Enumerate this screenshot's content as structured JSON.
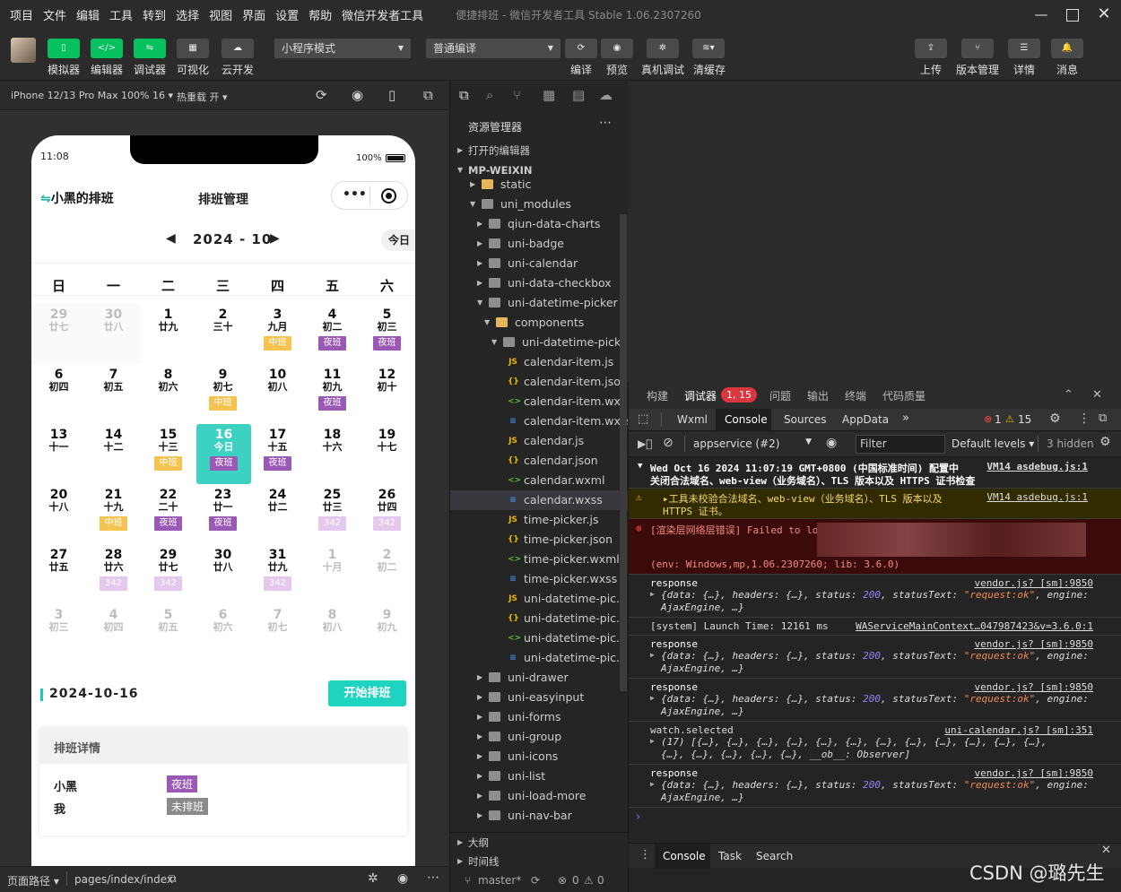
{
  "menubar": {
    "items": [
      "项目",
      "文件",
      "编辑",
      "工具",
      "转到",
      "选择",
      "视图",
      "界面",
      "设置",
      "帮助",
      "微信开发者工具"
    ],
    "title": "便捷排班 - 微信开发者工具 Stable 1.06.2307260"
  },
  "toolbar": {
    "left": [
      "模拟器",
      "编辑器",
      "调试器",
      "可视化",
      "云开发"
    ],
    "mode": "小程序模式",
    "compile": "普通编译",
    "actions": [
      "编译",
      "预览",
      "真机调试",
      "清缓存"
    ],
    "right": [
      "上传",
      "版本管理",
      "详情",
      "消息"
    ]
  },
  "simbar": {
    "device": "iPhone 12/13 Pro Max 100% 16",
    "hotreload": "热重载 开"
  },
  "phone": {
    "time": "11:08",
    "battery": "100%",
    "app_title": "小黑的排班",
    "page_title": "排班管理",
    "month": "2024 - 10",
    "today": "今日",
    "weekdays": [
      "日",
      "一",
      "二",
      "三",
      "四",
      "五",
      "六"
    ],
    "cells": [
      [
        "29",
        "廿七",
        "",
        1
      ],
      [
        "30",
        "廿八",
        "",
        1
      ],
      [
        "1",
        "廿九",
        "",
        0
      ],
      [
        "2",
        "三十",
        "",
        0
      ],
      [
        "3",
        "九月",
        "中班",
        0
      ],
      [
        "4",
        "初二",
        "夜班",
        0
      ],
      [
        "5",
        "初三",
        "夜班",
        0
      ],
      [
        "6",
        "初四",
        "",
        0
      ],
      [
        "7",
        "初五",
        "",
        0
      ],
      [
        "8",
        "初六",
        "",
        0
      ],
      [
        "9",
        "初七",
        "中班",
        0
      ],
      [
        "10",
        "初八",
        "",
        0
      ],
      [
        "11",
        "初九",
        "夜班",
        0
      ],
      [
        "12",
        "初十",
        "",
        0
      ],
      [
        "13",
        "十一",
        "",
        0
      ],
      [
        "14",
        "十二",
        "",
        0
      ],
      [
        "15",
        "十三",
        "中班",
        0
      ],
      [
        "16",
        "今日",
        "夜班",
        2
      ],
      [
        "17",
        "十五",
        "夜班",
        0
      ],
      [
        "18",
        "十六",
        "",
        0
      ],
      [
        "19",
        "十七",
        "",
        0
      ],
      [
        "20",
        "十八",
        "",
        0
      ],
      [
        "21",
        "十九",
        "中班",
        0
      ],
      [
        "22",
        "二十",
        "夜班",
        0
      ],
      [
        "23",
        "廿一",
        "夜班",
        0
      ],
      [
        "24",
        "廿二",
        "",
        0
      ],
      [
        "25",
        "廿三",
        "342",
        0
      ],
      [
        "26",
        "廿四",
        "342",
        0
      ],
      [
        "27",
        "廿五",
        "",
        0
      ],
      [
        "28",
        "廿六",
        "342",
        0
      ],
      [
        "29",
        "廿七",
        "342",
        0
      ],
      [
        "30",
        "廿八",
        "",
        0
      ],
      [
        "31",
        "廿九",
        "342",
        0
      ],
      [
        "1",
        "十月",
        "",
        1
      ],
      [
        "2",
        "初二",
        "",
        1
      ],
      [
        "3",
        "初三",
        "",
        1
      ],
      [
        "4",
        "初四",
        "",
        1
      ],
      [
        "5",
        "初五",
        "",
        1
      ],
      [
        "6",
        "初六",
        "",
        1
      ],
      [
        "7",
        "初七",
        "",
        1
      ],
      [
        "8",
        "初八",
        "",
        1
      ],
      [
        "9",
        "初九",
        "",
        1
      ]
    ],
    "tag_colors": {
      "中班": "#f5c350",
      "夜班": "#9b59b6",
      "342": "#e4c8ee",
      "未排班": "#8a8a8a"
    },
    "selected_date": "2024-10-16",
    "start_button": "开始排班",
    "detail_title": "排班详情",
    "detail_rows": [
      {
        "name": "小黑",
        "shift": "夜班"
      },
      {
        "name": "我",
        "shift": "未排班"
      }
    ]
  },
  "bottombar": {
    "path_label": "页面路径",
    "path": "pages/index/index"
  },
  "explorer": {
    "title": "资源管理器",
    "open_editors": "打开的编辑器",
    "root": "MP-WEIXIN",
    "outline": "大纲",
    "timeline": "时间线",
    "items": [
      {
        "label": "static",
        "depth": 1,
        "type": "folder-y",
        "open": false
      },
      {
        "label": "uni_modules",
        "depth": 1,
        "type": "folder",
        "open": true
      },
      {
        "label": "qiun-data-charts",
        "depth": 2,
        "type": "folder",
        "open": false
      },
      {
        "label": "uni-badge",
        "depth": 2,
        "type": "folder",
        "open": false
      },
      {
        "label": "uni-calendar",
        "depth": 2,
        "type": "folder",
        "open": false
      },
      {
        "label": "uni-data-checkbox",
        "depth": 2,
        "type": "folder",
        "open": false
      },
      {
        "label": "uni-datetime-picker",
        "depth": 2,
        "type": "folder",
        "open": true
      },
      {
        "label": "components",
        "depth": 3,
        "type": "folder-y",
        "open": true
      },
      {
        "label": "uni-datetime-picker",
        "depth": 4,
        "type": "folder",
        "open": true
      },
      {
        "label": "calendar-item.js",
        "depth": 5,
        "type": "js"
      },
      {
        "label": "calendar-item.json",
        "depth": 5,
        "type": "json"
      },
      {
        "label": "calendar-item.wx...",
        "depth": 5,
        "type": "wxml"
      },
      {
        "label": "calendar-item.wxss",
        "depth": 5,
        "type": "wxss"
      },
      {
        "label": "calendar.js",
        "depth": 5,
        "type": "js"
      },
      {
        "label": "calendar.json",
        "depth": 5,
        "type": "json"
      },
      {
        "label": "calendar.wxml",
        "depth": 5,
        "type": "wxml"
      },
      {
        "label": "calendar.wxss",
        "depth": 5,
        "type": "wxss",
        "selected": true
      },
      {
        "label": "time-picker.js",
        "depth": 5,
        "type": "js"
      },
      {
        "label": "time-picker.json",
        "depth": 5,
        "type": "json"
      },
      {
        "label": "time-picker.wxml",
        "depth": 5,
        "type": "wxml"
      },
      {
        "label": "time-picker.wxss",
        "depth": 5,
        "type": "wxss"
      },
      {
        "label": "uni-datetime-pic...",
        "depth": 5,
        "type": "js"
      },
      {
        "label": "uni-datetime-pic...",
        "depth": 5,
        "type": "json"
      },
      {
        "label": "uni-datetime-pic...",
        "depth": 5,
        "type": "wxml"
      },
      {
        "label": "uni-datetime-pic...",
        "depth": 5,
        "type": "wxss"
      },
      {
        "label": "uni-drawer",
        "depth": 2,
        "type": "folder",
        "open": false
      },
      {
        "label": "uni-easyinput",
        "depth": 2,
        "type": "folder",
        "open": false
      },
      {
        "label": "uni-forms",
        "depth": 2,
        "type": "folder",
        "open": false
      },
      {
        "label": "uni-group",
        "depth": 2,
        "type": "folder",
        "open": false
      },
      {
        "label": "uni-icons",
        "depth": 2,
        "type": "folder",
        "open": false
      },
      {
        "label": "uni-list",
        "depth": 2,
        "type": "folder",
        "open": false
      },
      {
        "label": "uni-load-more",
        "depth": 2,
        "type": "folder",
        "open": false
      },
      {
        "label": "uni-nav-bar",
        "depth": 2,
        "type": "folder",
        "open": false
      }
    ],
    "status": {
      "branch": "master*",
      "errors": "0",
      "warnings": "0"
    }
  },
  "debugger": {
    "tabs": [
      "构建",
      "调试器",
      "问题",
      "输出",
      "终端",
      "代码质量"
    ],
    "badge": "1, 15",
    "devtabs": [
      "Wxml",
      "Console",
      "Sources",
      "AppData"
    ],
    "err_count": "1",
    "warn_count": "15",
    "context": "appservice (#2)",
    "filter_placeholder": "Filter",
    "levels": "Default levels",
    "hidden": "3 hidden",
    "logs": [
      {
        "kind": "info",
        "text": "Wed Oct 16 2024 11:07:19 GMT+0800 (中国标准时间) 配置中",
        "text2": "关闭合法域名、web-view（业务域名）、TLS 版本以及 HTTPS 证书检查",
        "src": "VM14 asdebug.js:1"
      },
      {
        "kind": "warn",
        "text": "▸工具未校验合法域名、web-view（业务域名）、TLS 版本以及",
        "text2": "HTTPS 证书。",
        "src": "VM14 asdebug.js:1"
      },
      {
        "kind": "error",
        "text": "[渲染层网络层错误] Failed to lo",
        "text2": "(env: Windows,mp,1.06.2307260; lib: 3.6.0)"
      },
      {
        "kind": "resp",
        "text": "response",
        "src": "vendor.js? [sm]:9850"
      },
      {
        "kind": "sys",
        "text": "[system] Launch Time: 12161 ms",
        "src": "WAServiceMainContext…047987423&v=3.6.0:1"
      },
      {
        "kind": "resp",
        "text": "response",
        "src": "vendor.js? [sm]:9850"
      },
      {
        "kind": "resp",
        "text": "response",
        "src": "vendor.js? [sm]:9850"
      },
      {
        "kind": "watch",
        "text": "watch.selected",
        "text2": "(17) [{…}, {…}, {…}, {…}, {…}, {…}, {…}, {…}, {…}, {…}, {…}, {…},",
        "text3": "{…}, {…}, {…}, {…}, {…}, __ob__: Observer]",
        "src": "uni-calendar.js? [sm]:351"
      },
      {
        "kind": "resp",
        "text": "response",
        "src": "vendor.js? [sm]:9850"
      }
    ],
    "resp_line1a": "{data: {…}, headers: {…}, status: ",
    "resp_status": "200",
    "resp_line1b": ", statusText: ",
    "resp_ok": "\"request:ok\"",
    "resp_line1c": ", engine:",
    "resp_line2": "AjaxEngine, …}",
    "bottom_tabs": [
      "Console",
      "Task",
      "Search"
    ],
    "watermark": "CSDN @璐先生"
  }
}
